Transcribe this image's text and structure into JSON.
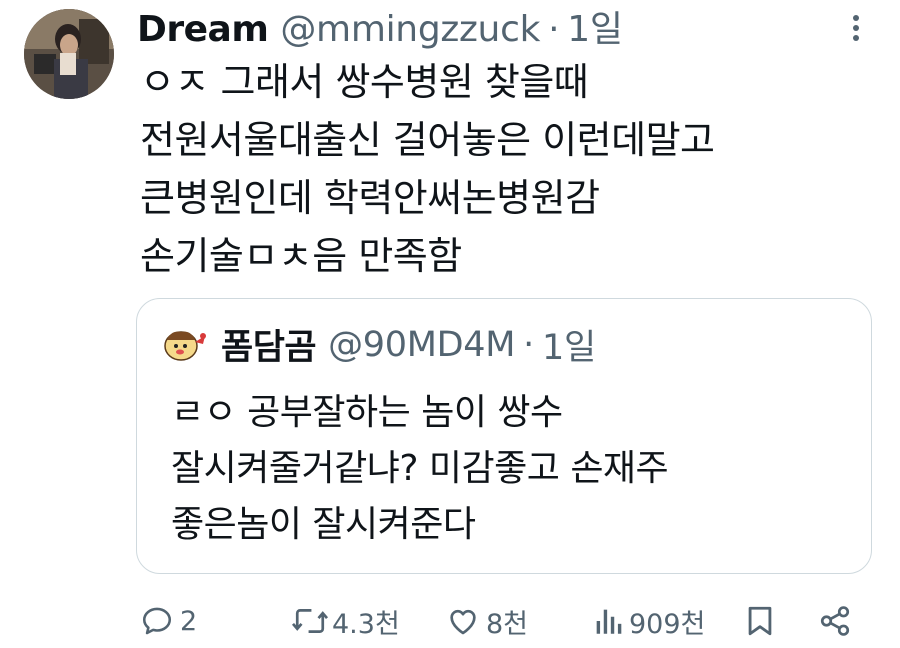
{
  "tweet": {
    "author_name": "Dream",
    "author_handle": "@mmingzzuck",
    "separator": "·",
    "time": "1일",
    "lines": [
      "ㅇㅈ 그래서 쌍수병원 찾을때",
      "전원서울대출신 걸어놓은 이런데말고",
      "큰병원인데 학력안써논병원감",
      "손기술ㅁㅊ음 만족함"
    ]
  },
  "quoted": {
    "author_name": "폼담곰",
    "author_handle": "@90MD4M",
    "separator": "·",
    "time": "1일",
    "lines": [
      "ㄹㅇ 공부잘하는 놈이 쌍수",
      "잘시켜줄거같냐? 미감좋고 손재주",
      "좋은놈이 잘시켜준다"
    ]
  },
  "actions": {
    "reply_count": "2",
    "retweet_count": "4.3천",
    "like_count": "8천",
    "view_count": "909천"
  },
  "icons": [
    "more-icon",
    "reply-icon",
    "retweet-icon",
    "like-icon",
    "views-icon",
    "bookmark-icon",
    "share-icon"
  ],
  "colors": {
    "text": "#0f1419",
    "secondary": "#536471",
    "border": "#cfd9de"
  }
}
